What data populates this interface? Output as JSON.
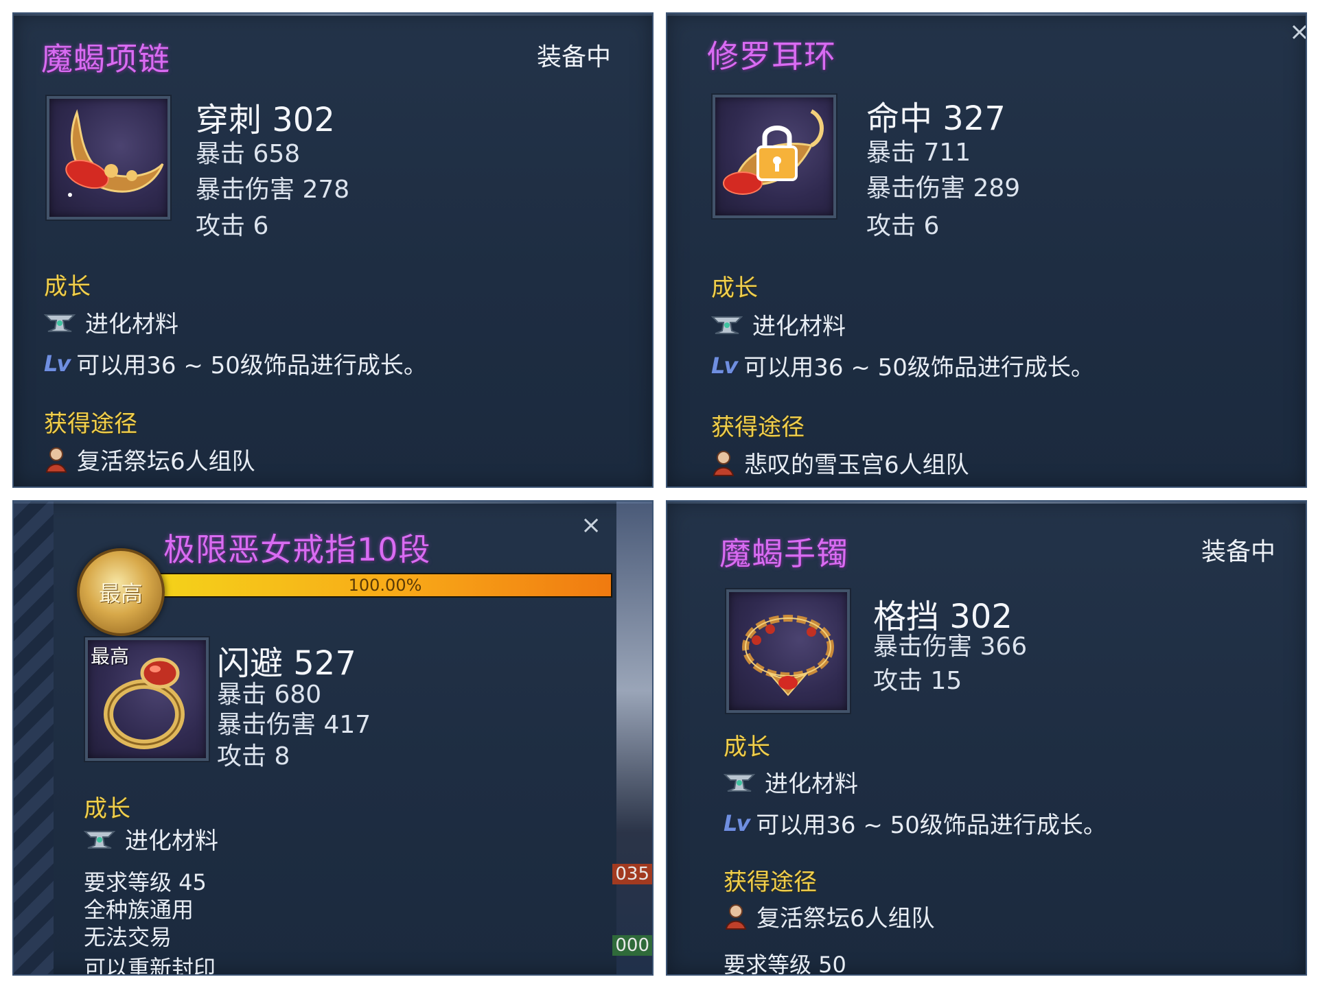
{
  "colors": {
    "item_name": "#d86cf2",
    "section_header": "#f0cf4e",
    "panel_bg": "#223249",
    "progress": "#f7a51a"
  },
  "panels": [
    {
      "name": "魔蝎项链",
      "status": "装备中",
      "icon": "necklace-icon",
      "main_stat": "穿刺 302",
      "stats": [
        "暴击 658",
        "暴击伤害 278",
        "攻击 6"
      ],
      "growth_header": "成长",
      "growth_material": "进化材料",
      "growth_note": "可以用36 ~ 50级饰品进行成长。",
      "source_header": "获得途径",
      "source": "复活祭坛6人组队"
    },
    {
      "name": "修罗耳环",
      "close": "×",
      "icon": "earring-locked-icon",
      "main_stat": "命中 327",
      "stats": [
        "暴击 711",
        "暴击伤害 289",
        "攻击 6"
      ],
      "growth_header": "成长",
      "growth_material": "进化材料",
      "growth_note": "可以用36 ~ 50级饰品进行成长。",
      "source_header": "获得途径",
      "source": "悲叹的雪玉宫6人组队"
    },
    {
      "name": "极限恶女戒指10段",
      "close": "×",
      "icon": "ring-icon",
      "badge": "最高",
      "icon_tag": "最高",
      "progress_label": "100.00%",
      "progress_value": 1.0,
      "main_stat": "闪避 527",
      "stats": [
        "暴击 680",
        "暴击伤害 417",
        "攻击 8"
      ],
      "growth_header": "成长",
      "growth_material": "进化材料",
      "requirements": [
        "要求等级 45",
        "全种族通用",
        "无法交易",
        "可以重新封印"
      ],
      "bg_numbers": [
        "035",
        "000"
      ]
    },
    {
      "name": "魔蝎手镯",
      "status": "装备中",
      "icon": "bracelet-icon",
      "main_stat": "格挡 302",
      "stats": [
        "暴击伤害 366",
        "攻击 15"
      ],
      "growth_header": "成长",
      "growth_material": "进化材料",
      "growth_note": "可以用36 ~ 50级饰品进行成长。",
      "source_header": "获得途径",
      "source": "复活祭坛6人组队",
      "requirement": "要求等级 50"
    }
  ]
}
